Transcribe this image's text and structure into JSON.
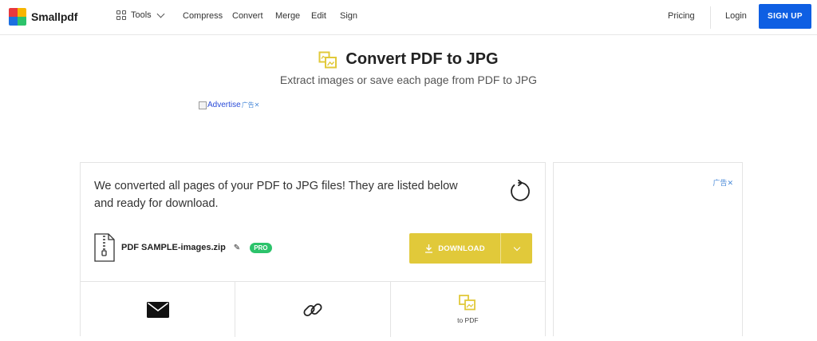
{
  "header": {
    "logo_text": "Smallpdf",
    "tools_label": "Tools",
    "nav": [
      "Compress",
      "Convert",
      "Merge",
      "Edit",
      "Sign"
    ],
    "pricing": "Pricing",
    "login": "Login",
    "signup": "SIGN UP",
    "signup_color": "#0e5fe3"
  },
  "page": {
    "title": "Convert PDF to JPG",
    "subtitle": "Extract images or save each page from PDF to JPG",
    "ad_alt_text": "Advertise",
    "ad_badge": "广告✕"
  },
  "result": {
    "message": "We converted all pages of your PDF to JPG files! They are listed below and ready for download.",
    "file_name": "PDF SAMPLE-images.zip",
    "pro_badge": "PRO",
    "download_label": "DOWNLOAD",
    "accent_color": "#e1c93a",
    "actions": [
      {
        "icon": "envelope-icon",
        "label": ""
      },
      {
        "icon": "link-icon",
        "label": ""
      },
      {
        "icon": "to-pdf-icon",
        "label": "to PDF"
      }
    ]
  },
  "side_ad": {
    "badge": "广告✕"
  }
}
